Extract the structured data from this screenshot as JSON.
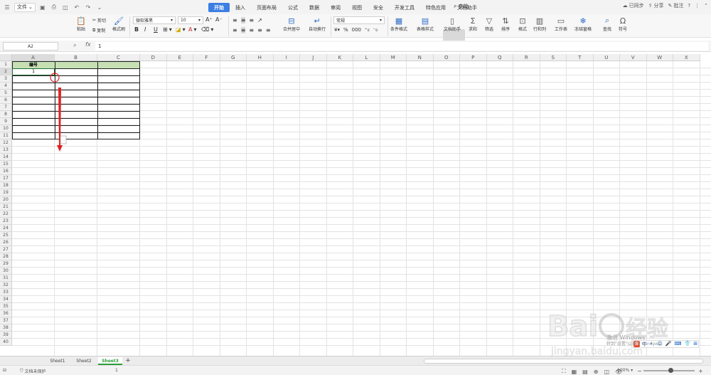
{
  "menubar": {
    "file_label": "文件",
    "tabs": [
      "开始",
      "插入",
      "页面布局",
      "公式",
      "数据",
      "审阅",
      "视图",
      "安全",
      "开发工具",
      "特色应用",
      "文档助手"
    ],
    "active_tab": "开始",
    "search_label": "查找",
    "sync_label": "已同步",
    "share_label": "分享",
    "comment_label": "批注",
    "help_label": "?"
  },
  "ribbon": {
    "paste_label": "粘贴",
    "cut_label": "剪切",
    "copy_label": "复制",
    "format_painter_label": "格式刷",
    "font_name": "微软雅黑",
    "font_size": "10",
    "bold": "B",
    "italic": "I",
    "underline": "U",
    "merge_center_label": "合并居中",
    "wrap_text_label": "自动换行",
    "number_format": "常规",
    "percent": "%",
    "conditional_format_label": "条件格式",
    "table_style_label": "表格样式",
    "doc_helper_label": "文档助手",
    "sum_label": "求和",
    "filter_label": "筛选",
    "sort_label": "排序",
    "format_label": "格式",
    "rowcol_label": "行和列",
    "worksheet_label": "工作表",
    "freeze_label": "冻结窗格",
    "find_label": "查找",
    "symbol_label": "符号"
  },
  "formula": {
    "name_box": "A2",
    "fx_label": "fx",
    "value": "1"
  },
  "grid": {
    "columns": [
      "A",
      "B",
      "C",
      "D",
      "E",
      "F",
      "G",
      "H",
      "I",
      "J",
      "K",
      "L",
      "M",
      "N",
      "O",
      "P",
      "Q",
      "R",
      "S",
      "T",
      "U",
      "V",
      "W",
      "X"
    ],
    "rows": [
      "1",
      "2",
      "3",
      "4",
      "5",
      "6",
      "7",
      "8",
      "9",
      "10",
      "11",
      "12",
      "13",
      "14",
      "15",
      "16",
      "17",
      "18",
      "19",
      "20",
      "21",
      "22",
      "23",
      "24",
      "25",
      "26",
      "27",
      "28",
      "29",
      "30",
      "31",
      "32",
      "33",
      "34",
      "35",
      "36",
      "37",
      "38",
      "39",
      "40"
    ],
    "header_cell": "编号",
    "a2_value": "1",
    "header_fill": "#c6e0b4"
  },
  "sheets": {
    "tabs": [
      "Sheet1",
      "Sheet2",
      "Sheet3"
    ],
    "active": "Sheet3",
    "add_label": "+"
  },
  "status": {
    "protect_label": "文档未保护",
    "cell_value": "1",
    "zoom_label": "100%",
    "minus": "−",
    "plus": "+"
  },
  "ime": {
    "items": [
      "中",
      "•,",
      "☺",
      "🎤",
      "⌨",
      "👕",
      "⊞"
    ]
  },
  "watermark": {
    "activate_line1": "激活 Windows",
    "activate_line2": "转到\"设置\"以激活 Windows。"
  },
  "colors": {
    "accent": "#3c7ee3",
    "sheet_active": "#2b9e3a",
    "drag_arrow": "#e02020"
  }
}
